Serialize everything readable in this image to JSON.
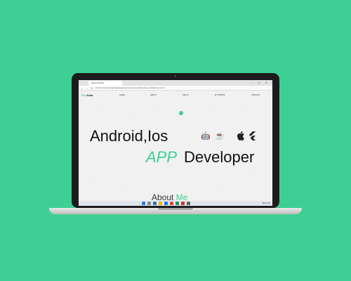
{
  "browser": {
    "tab_title": "Safesci Portfolio",
    "window_controls": "– ▢ ✕",
    "nav_icons": "← → ↻",
    "url": "file:///C:/Users/nmnsgdfesqs/pages/web-development/Projectuns.portfolio/index.html#"
  },
  "site": {
    "logo_main": "Port",
    "logo_accent": "folio",
    "nav": [
      "HOME",
      "ABOUT",
      "SKILLS",
      "MY WORKS",
      "CONTACT"
    ]
  },
  "hero": {
    "line1": "Android,Ios",
    "accent": "APP",
    "rest": "Developer",
    "tech_icons": [
      "android-icon",
      "java-icon",
      "apple-icon",
      "flutter-icon"
    ],
    "tech_glyphs": [
      "🤖",
      "☕",
      "",
      "◢"
    ]
  },
  "about": {
    "text": "About ",
    "accent": "Me"
  },
  "taskbar": {
    "tray": "ENG 9:41"
  },
  "colors": {
    "accent": "#3ecf94",
    "background": "#3ecf94"
  }
}
